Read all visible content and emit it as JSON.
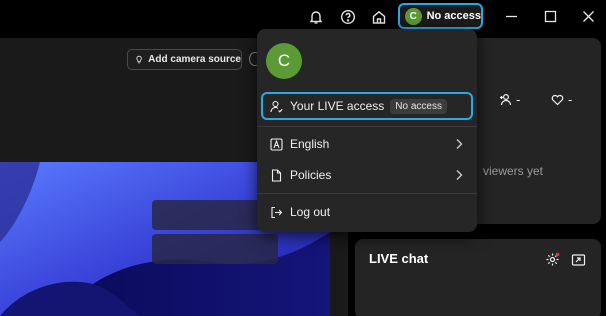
{
  "titlebar": {
    "account_avatar_initial": "C",
    "account_status": "No access",
    "icons": [
      "bell-icon",
      "help-icon",
      "home-icon",
      "minimize-icon",
      "maximize-icon",
      "close-icon"
    ]
  },
  "main": {
    "add_camera_label": "Add camera source"
  },
  "stats": {
    "followers_value": "-",
    "likes_value": "-",
    "viewers_text": "viewers yet"
  },
  "chat": {
    "title": "LIVE chat"
  },
  "menu": {
    "avatar_initial": "C",
    "items": [
      {
        "label": "Your LIVE access",
        "badge": "No access",
        "icon": "user-check-icon"
      },
      {
        "label": "English",
        "icon": "language-icon"
      },
      {
        "label": "Policies",
        "icon": "document-icon"
      },
      {
        "label": "Log out",
        "icon": "logout-icon"
      }
    ]
  },
  "colors": {
    "accent_outline": "#29a9e6",
    "avatar_green": "#5b9a35",
    "menu_bg": "#262626"
  }
}
